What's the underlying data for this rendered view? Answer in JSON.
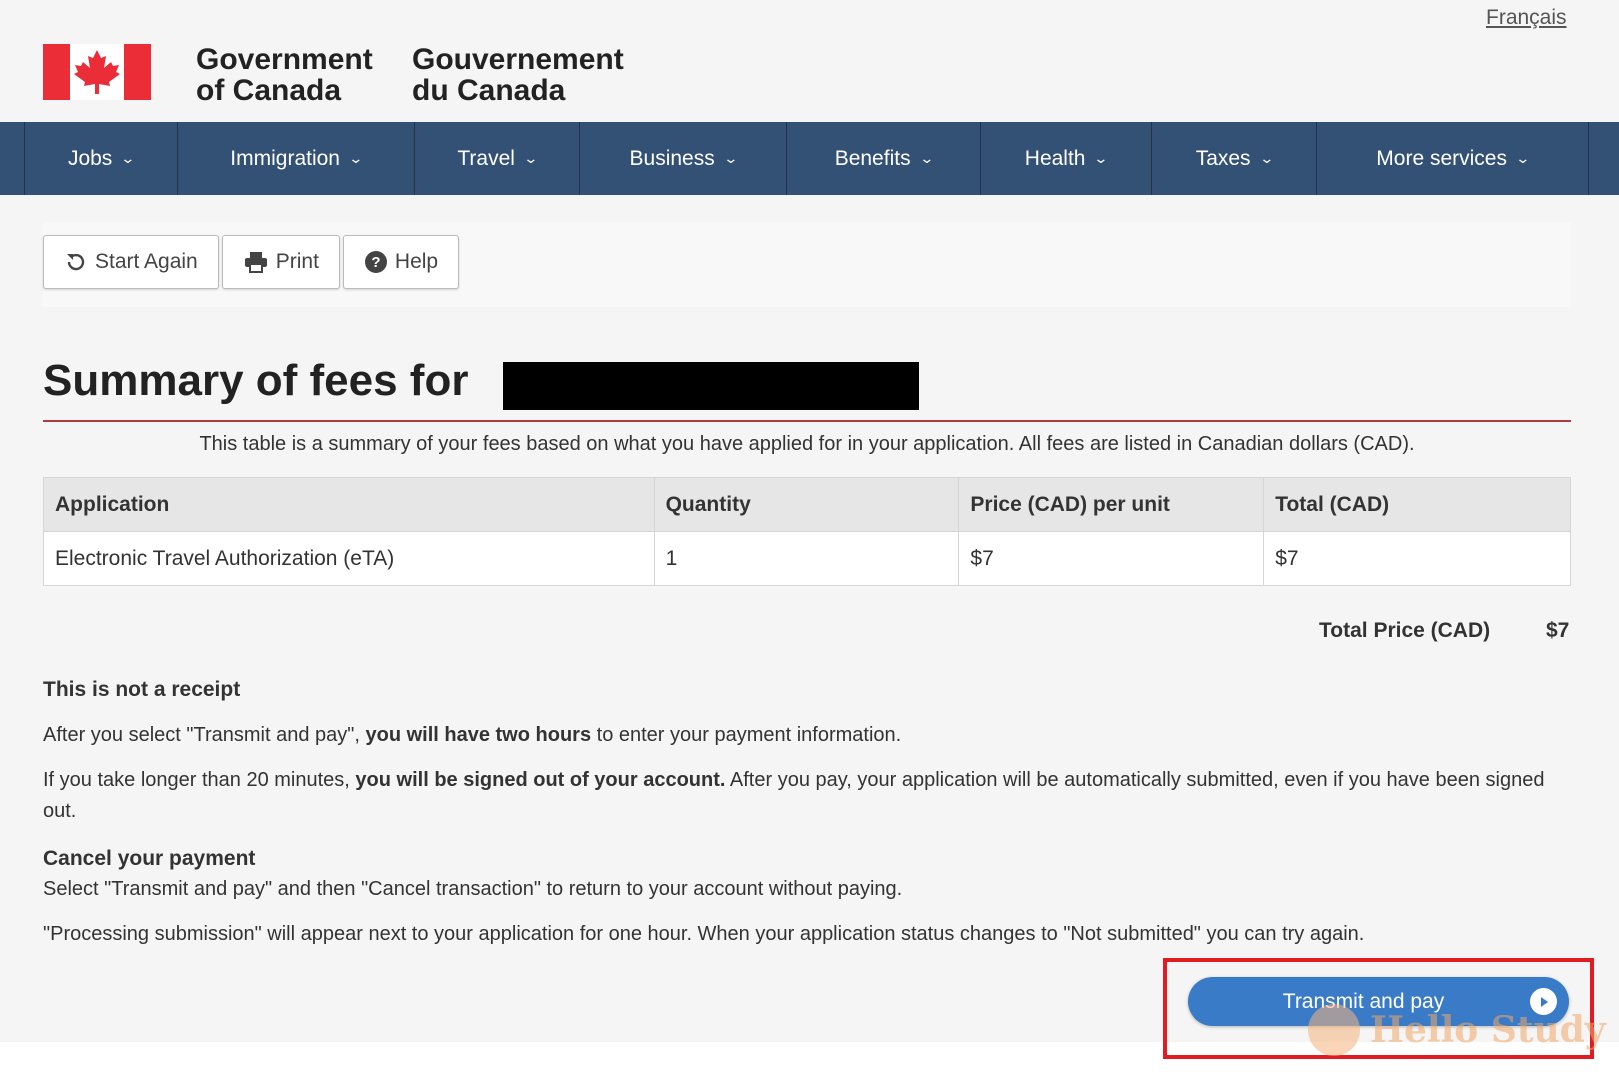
{
  "header": {
    "language_link": "Français",
    "signature_en": [
      "Government",
      "of Canada"
    ],
    "signature_fr": [
      "Gouvernement",
      "du Canada"
    ],
    "flag_colors": {
      "red": "#eb2d37",
      "white": "#ffffff"
    }
  },
  "nav": {
    "items": [
      {
        "label": "Jobs"
      },
      {
        "label": "Immigration"
      },
      {
        "label": "Travel"
      },
      {
        "label": "Business"
      },
      {
        "label": "Benefits"
      },
      {
        "label": "Health"
      },
      {
        "label": "Taxes"
      },
      {
        "label": "More services"
      }
    ],
    "background": "#335075"
  },
  "toolbar": {
    "start_again": "Start Again",
    "print": "Print",
    "help": "Help"
  },
  "page": {
    "title": "Summary of fees for",
    "intro": "This table is a summary of your fees based on what you have applied for in your application. All fees are listed in Canadian dollars (CAD)."
  },
  "fees_table": {
    "headers": [
      "Application",
      "Quantity",
      "Price (CAD) per unit",
      "Total (CAD)"
    ],
    "rows": [
      [
        "Electronic Travel Authorization (eTA)",
        "1",
        "$7",
        "$7"
      ]
    ]
  },
  "total": {
    "label": "Total Price (CAD)",
    "value": "$7"
  },
  "notice": {
    "receipt_heading": "This is not a receipt",
    "p1_pre": "After you select \"Transmit and pay\", ",
    "p1_bold": "you will have two hours",
    "p1_post": " to enter your payment information.",
    "p2_pre": "If you take longer than 20 minutes, ",
    "p2_bold": "you will be signed out of your account.",
    "p2_post": " After you pay, your application will be automatically submitted, even if you have been signed out.",
    "cancel_heading": "Cancel your payment",
    "p3": "Select \"Transmit and pay\" and then \"Cancel transaction\" to return to your account without paying.",
    "p4": "\"Processing submission\" will appear next to your application for one hour. When your application status changes to \"Not submitted\" you can try again."
  },
  "action": {
    "transmit_label": "Transmit and pay",
    "button_color": "#3a7bc8",
    "highlight_color": "#e21b23"
  },
  "watermark": {
    "text": "Hello Study"
  }
}
